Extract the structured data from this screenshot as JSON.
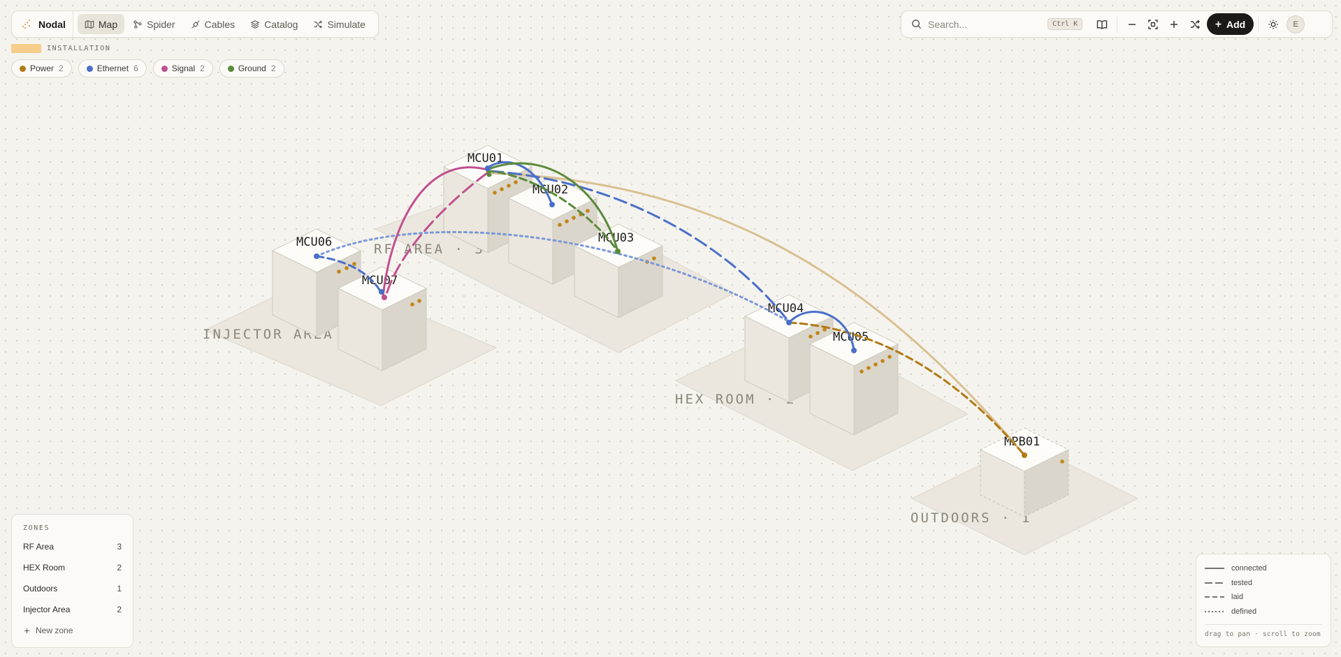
{
  "app": {
    "name": "Nodal"
  },
  "nav": {
    "items": [
      {
        "label": "Map",
        "icon": "map-icon"
      },
      {
        "label": "Spider",
        "icon": "spider-icon"
      },
      {
        "label": "Cables",
        "icon": "cable-icon"
      },
      {
        "label": "Catalog",
        "icon": "layers-icon"
      },
      {
        "label": "Simulate",
        "icon": "shuffle-icon"
      }
    ],
    "active": "Map"
  },
  "installation": {
    "label": "INSTALLATION",
    "color": "#f6cd8b"
  },
  "filters": [
    {
      "label": "Power",
      "count": "2",
      "color": "#b07a15"
    },
    {
      "label": "Ethernet",
      "count": "6",
      "color": "#4a6fc9"
    },
    {
      "label": "Signal",
      "count": "2",
      "color": "#c0508f"
    },
    {
      "label": "Ground",
      "count": "2",
      "color": "#5a8a3a"
    }
  ],
  "search": {
    "placeholder": "Search...",
    "shortcut": "Ctrl K"
  },
  "actions": {
    "add_label": "Add",
    "avatar_initial": "E"
  },
  "map": {
    "zones": [
      {
        "label": "INJECTOR AREA · 2"
      },
      {
        "label": "RF AREA · 3"
      },
      {
        "label": "HEX ROOM · 2"
      },
      {
        "label": "OUTDOORS · 1"
      }
    ],
    "devices": [
      {
        "label": "MCU01"
      },
      {
        "label": "MCU02"
      },
      {
        "label": "MCU03"
      },
      {
        "label": "MCU06"
      },
      {
        "label": "MCU07"
      },
      {
        "label": "MCU04"
      },
      {
        "label": "MCU05"
      },
      {
        "label": "MPB01"
      }
    ],
    "cable_colors": {
      "power": "#b07a15",
      "ethernet": "#4a6fc9",
      "signal": "#c0508f",
      "ground": "#5a8a3a",
      "power_light": "#d9c08f"
    }
  },
  "zones_panel": {
    "title": "ZONES",
    "items": [
      {
        "label": "RF Area",
        "count": "3"
      },
      {
        "label": "HEX Room",
        "count": "2"
      },
      {
        "label": "Outdoors",
        "count": "1"
      },
      {
        "label": "Injector Area",
        "count": "2"
      }
    ],
    "new_zone_label": "New zone"
  },
  "legend": {
    "items": [
      {
        "label": "connected",
        "style": "solid"
      },
      {
        "label": "tested",
        "style": "long-dash"
      },
      {
        "label": "laid",
        "style": "dash"
      },
      {
        "label": "defined",
        "style": "dot"
      }
    ],
    "hint": "drag to pan · scroll to zoom"
  }
}
